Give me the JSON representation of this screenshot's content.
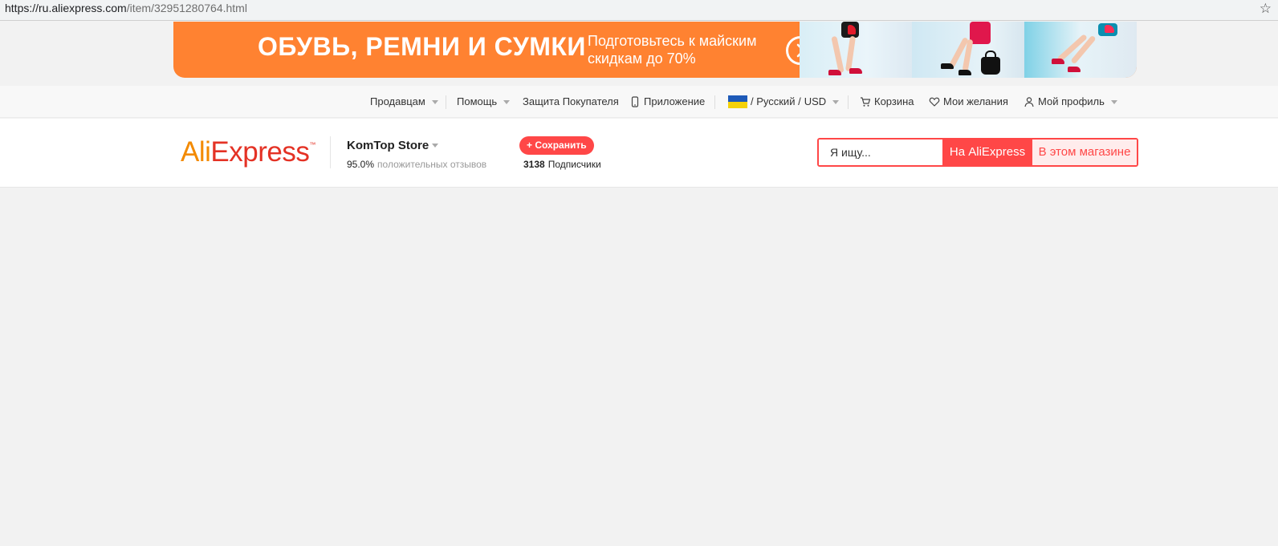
{
  "browser": {
    "url_host": "https://ru.aliexpress.com",
    "url_path": "/item/32951280764.html",
    "bookmark_icon": "star-icon"
  },
  "banner": {
    "title": "ОБУВЬ, РЕМНИ И СУМКИ",
    "subtitle": "Подготовьтесь к майским скидкам до 70%",
    "arrow_icon": "chevron-right-icon",
    "bg_color": "#ff8231"
  },
  "topnav": {
    "sellers": "Продавцам",
    "help": "Помощь",
    "buyer_protection": "Защита Покупателя",
    "app": "Приложение",
    "region_lang": "/ Русский /",
    "currency": "USD",
    "cart": "Корзина",
    "wishlist": "Мои желания",
    "profile": "Мой профиль"
  },
  "header": {
    "logo_part1": "Ali",
    "logo_part2": "Express",
    "logo_tm": "™",
    "store_name": "KomTop Store",
    "rating_pct": "95.0%",
    "rating_label": "положительных отзывов",
    "save_label": "+ Сохранить",
    "followers_count": "3138",
    "followers_label": "Подписчики"
  },
  "search": {
    "placeholder": "Я ищу...",
    "btn_aliexpress": "На AliExpress",
    "btn_store": "В этом магазине",
    "accent_color": "#ff4747"
  }
}
